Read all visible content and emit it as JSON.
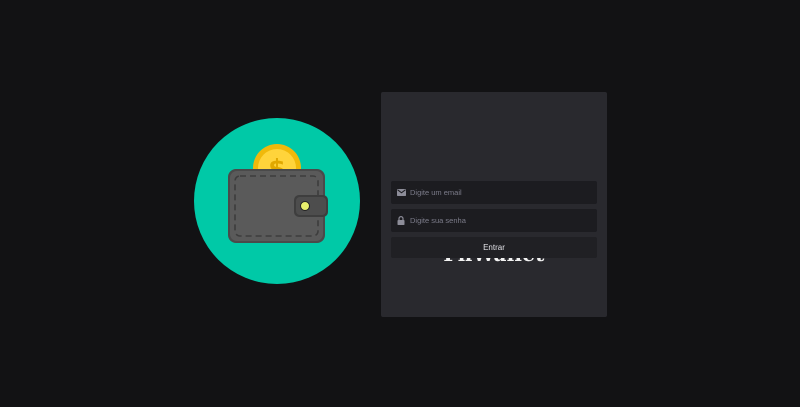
{
  "app": {
    "title": "FnWallet"
  },
  "logo": {
    "icon": "wallet-coin-icon",
    "circle_color": "#00c9a7",
    "coin_symbol": "$"
  },
  "login": {
    "email": {
      "icon": "mail-icon",
      "placeholder": "Digite um email",
      "value": ""
    },
    "password": {
      "icon": "lock-icon",
      "placeholder": "Digite sua senha",
      "value": ""
    },
    "submit_label": "Entrar"
  },
  "colors": {
    "background": "#121214",
    "card": "#29292e",
    "input": "#1c1c20",
    "button": "#202024",
    "text": "#f2f2f2"
  }
}
